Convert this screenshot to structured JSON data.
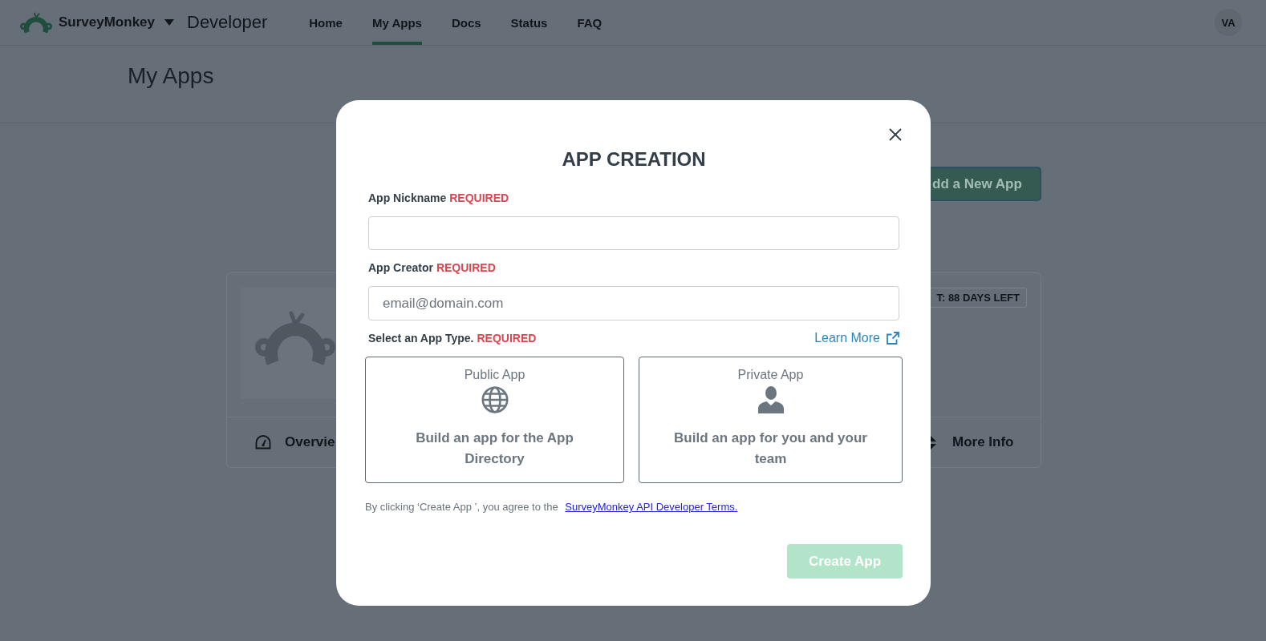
{
  "header": {
    "brand": "SurveyMonkey",
    "product": "Developer",
    "nav": [
      {
        "label": "Home",
        "selected": false
      },
      {
        "label": "My Apps",
        "selected": true
      },
      {
        "label": "Docs",
        "selected": false
      },
      {
        "label": "Status",
        "selected": false
      },
      {
        "label": "FAQ",
        "selected": false
      }
    ],
    "avatar": "VA"
  },
  "page": {
    "title": "My Apps",
    "add_button": "dd a New App",
    "app_card": {
      "overview_link": "Overvie",
      "badge": "T: 88 DAYS LEFT",
      "more_info_link": "More Info"
    }
  },
  "modal": {
    "title": "APP CREATION",
    "fields": [
      {
        "label": "App Nickname",
        "required_tag": "REQUIRED"
      },
      {
        "label": "App Creator",
        "required_tag": "REQUIRED",
        "placeholder": "email@domain.com"
      }
    ],
    "app_type": {
      "label": "Select an App Type.",
      "required_tag": "REQUIRED",
      "learn_more": "Learn More",
      "options": [
        {
          "kind": "public",
          "title": "Public App",
          "description": "Build an app for the App Directory",
          "selected": false
        },
        {
          "kind": "private",
          "title": "Private App",
          "description": "Build an app for you and your team",
          "selected": false
        }
      ]
    },
    "terms": {
      "text": "By clicking ‘Create App ’, you agree to the",
      "link": "SurveyMonkey API Developer Terms."
    },
    "submit": {
      "label": "Create App",
      "disabled": true
    }
  }
}
